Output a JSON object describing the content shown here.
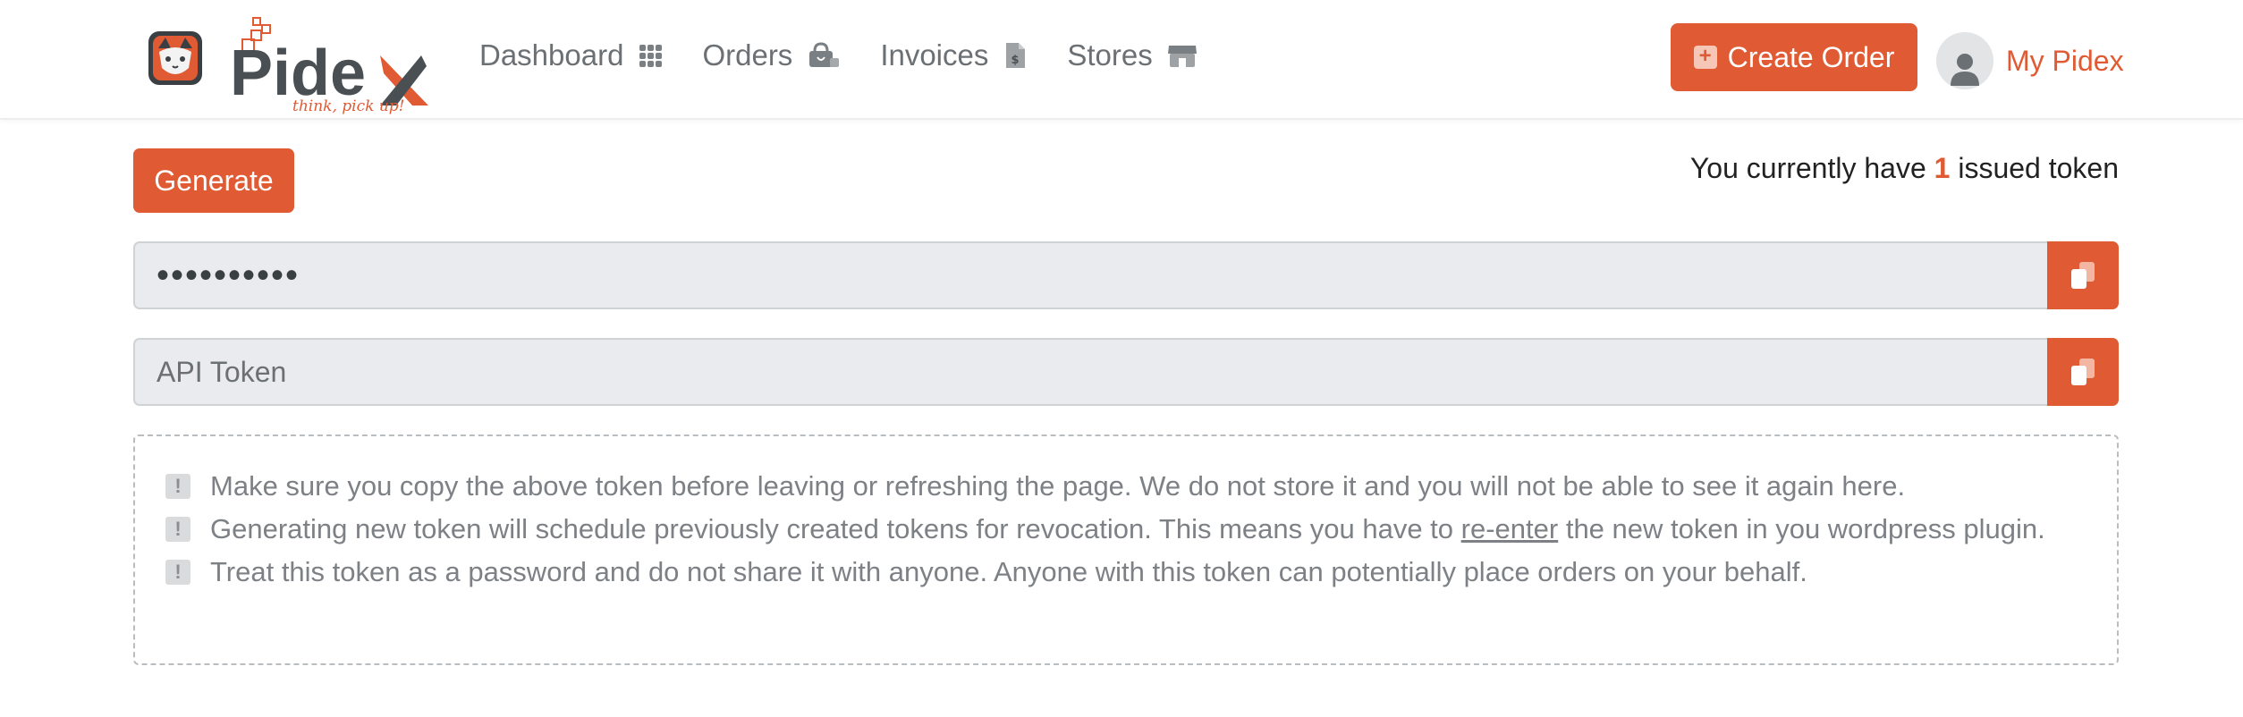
{
  "brand": {
    "name": "Pidex",
    "tagline": "think, pick up!"
  },
  "nav": [
    {
      "label": "Dashboard",
      "icon": "grid-icon"
    },
    {
      "label": "Orders",
      "icon": "shopping-bag-icon"
    },
    {
      "label": "Invoices",
      "icon": "invoice-icon"
    },
    {
      "label": "Stores",
      "icon": "store-icon"
    }
  ],
  "header": {
    "create_order_label": "Create Order",
    "user_label": "My Pidex"
  },
  "main": {
    "generate_label": "Generate",
    "token_count_prefix": "You currently have",
    "token_count": "1",
    "token_count_suffix": "issued token",
    "token_value": "••••••••••",
    "api_token_placeholder": "API Token"
  },
  "notes": {
    "note1": "Make sure you copy the above token before leaving or refreshing the page. We do not store it and you will not be able to see it again here.",
    "note2_before": "Generating new token will schedule previously created tokens for revocation. This means you have to",
    "note2_link": "re-enter",
    "note2_after": "the new token in you wordpress plugin.",
    "note3": "Treat this token as a password and do not share it with anyone. Anyone with this token can potentially place orders on your behalf."
  },
  "colors": {
    "accent": "#e05a33",
    "text": "#3f4549",
    "field": "#e9ebee"
  }
}
